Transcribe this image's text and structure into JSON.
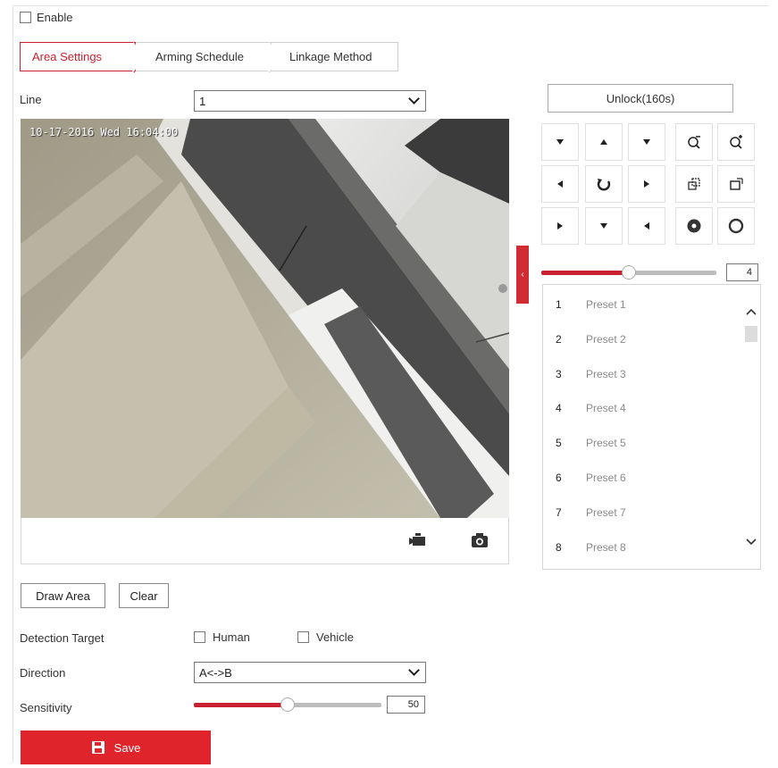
{
  "enable": {
    "label": "Enable",
    "checked": false
  },
  "tabs": [
    {
      "label": "Area Settings",
      "active": true
    },
    {
      "label": "Arming Schedule",
      "active": false
    },
    {
      "label": "Linkage Method",
      "active": false
    }
  ],
  "line": {
    "label": "Line",
    "value": "1"
  },
  "video": {
    "osd_text": "10-17-2016 Wed 16:04:00",
    "record_icon": "video-record-icon",
    "snapshot_icon": "camera-snapshot-icon"
  },
  "ptz": {
    "unlock_label": "Unlock(160s)",
    "speed_value": "4",
    "speed_fraction": 0.5,
    "buttons": [
      {
        "name": "ptz-up-left-icon"
      },
      {
        "name": "ptz-up-icon"
      },
      {
        "name": "ptz-up-right-icon"
      },
      {
        "name": "zoom-out-icon"
      },
      {
        "name": "zoom-in-icon"
      },
      {
        "name": "ptz-left-icon"
      },
      {
        "name": "ptz-auto-rotate-icon"
      },
      {
        "name": "ptz-right-icon"
      },
      {
        "name": "focus-near-icon"
      },
      {
        "name": "focus-far-icon"
      },
      {
        "name": "ptz-down-left-icon"
      },
      {
        "name": "ptz-down-icon"
      },
      {
        "name": "ptz-down-right-icon"
      },
      {
        "name": "iris-open-icon"
      },
      {
        "name": "iris-close-icon"
      }
    ],
    "presets": [
      {
        "num": "1",
        "name": "Preset 1"
      },
      {
        "num": "2",
        "name": "Preset 2"
      },
      {
        "num": "3",
        "name": "Preset 3"
      },
      {
        "num": "4",
        "name": "Preset 4"
      },
      {
        "num": "5",
        "name": "Preset 5"
      },
      {
        "num": "6",
        "name": "Preset 6"
      },
      {
        "num": "7",
        "name": "Preset 7"
      },
      {
        "num": "8",
        "name": "Preset 8"
      }
    ]
  },
  "actions": {
    "draw_area": "Draw Area",
    "clear": "Clear"
  },
  "detection": {
    "label": "Detection Target",
    "human": "Human",
    "vehicle": "Vehicle",
    "human_checked": false,
    "vehicle_checked": false
  },
  "direction": {
    "label": "Direction",
    "value": "A<->B"
  },
  "sensitivity": {
    "label": "Sensitivity",
    "value": "50",
    "fraction": 0.5
  },
  "save": {
    "label": "Save"
  },
  "colors": {
    "accent": "#c9212f",
    "save_bg": "#e0242b"
  }
}
